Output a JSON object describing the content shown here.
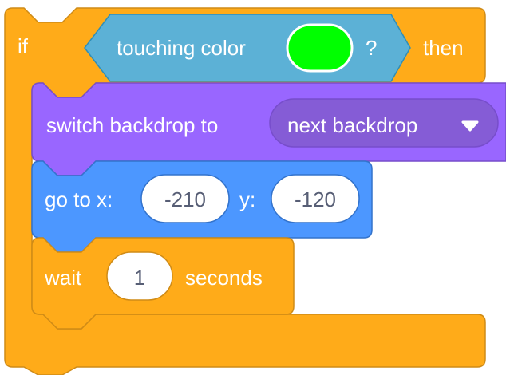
{
  "colors": {
    "control": "#ffab19",
    "control_border": "#cf8b17",
    "sensing": "#5cb1d6",
    "sensing_border": "#2e8eb8",
    "looks": "#9966ff",
    "looks_border": "#774dcb",
    "looks_menu": "#855cd6",
    "motion": "#4c97ff",
    "motion_border": "#3373cc",
    "touch_color_swatch": "#00ff00"
  },
  "if_block": {
    "if_label": "if",
    "then_label": "then"
  },
  "condition": {
    "label": "touching color",
    "question_mark": "?",
    "color_name": "green"
  },
  "switch_backdrop": {
    "label": "switch backdrop to",
    "menu_value": "next backdrop",
    "menu_icon": "caret-down-icon"
  },
  "go_to": {
    "x_label": "go to x:",
    "x_value": "-210",
    "y_label": "y:",
    "y_value": "-120"
  },
  "wait": {
    "label": "wait",
    "value": "1",
    "unit_label": "seconds"
  }
}
